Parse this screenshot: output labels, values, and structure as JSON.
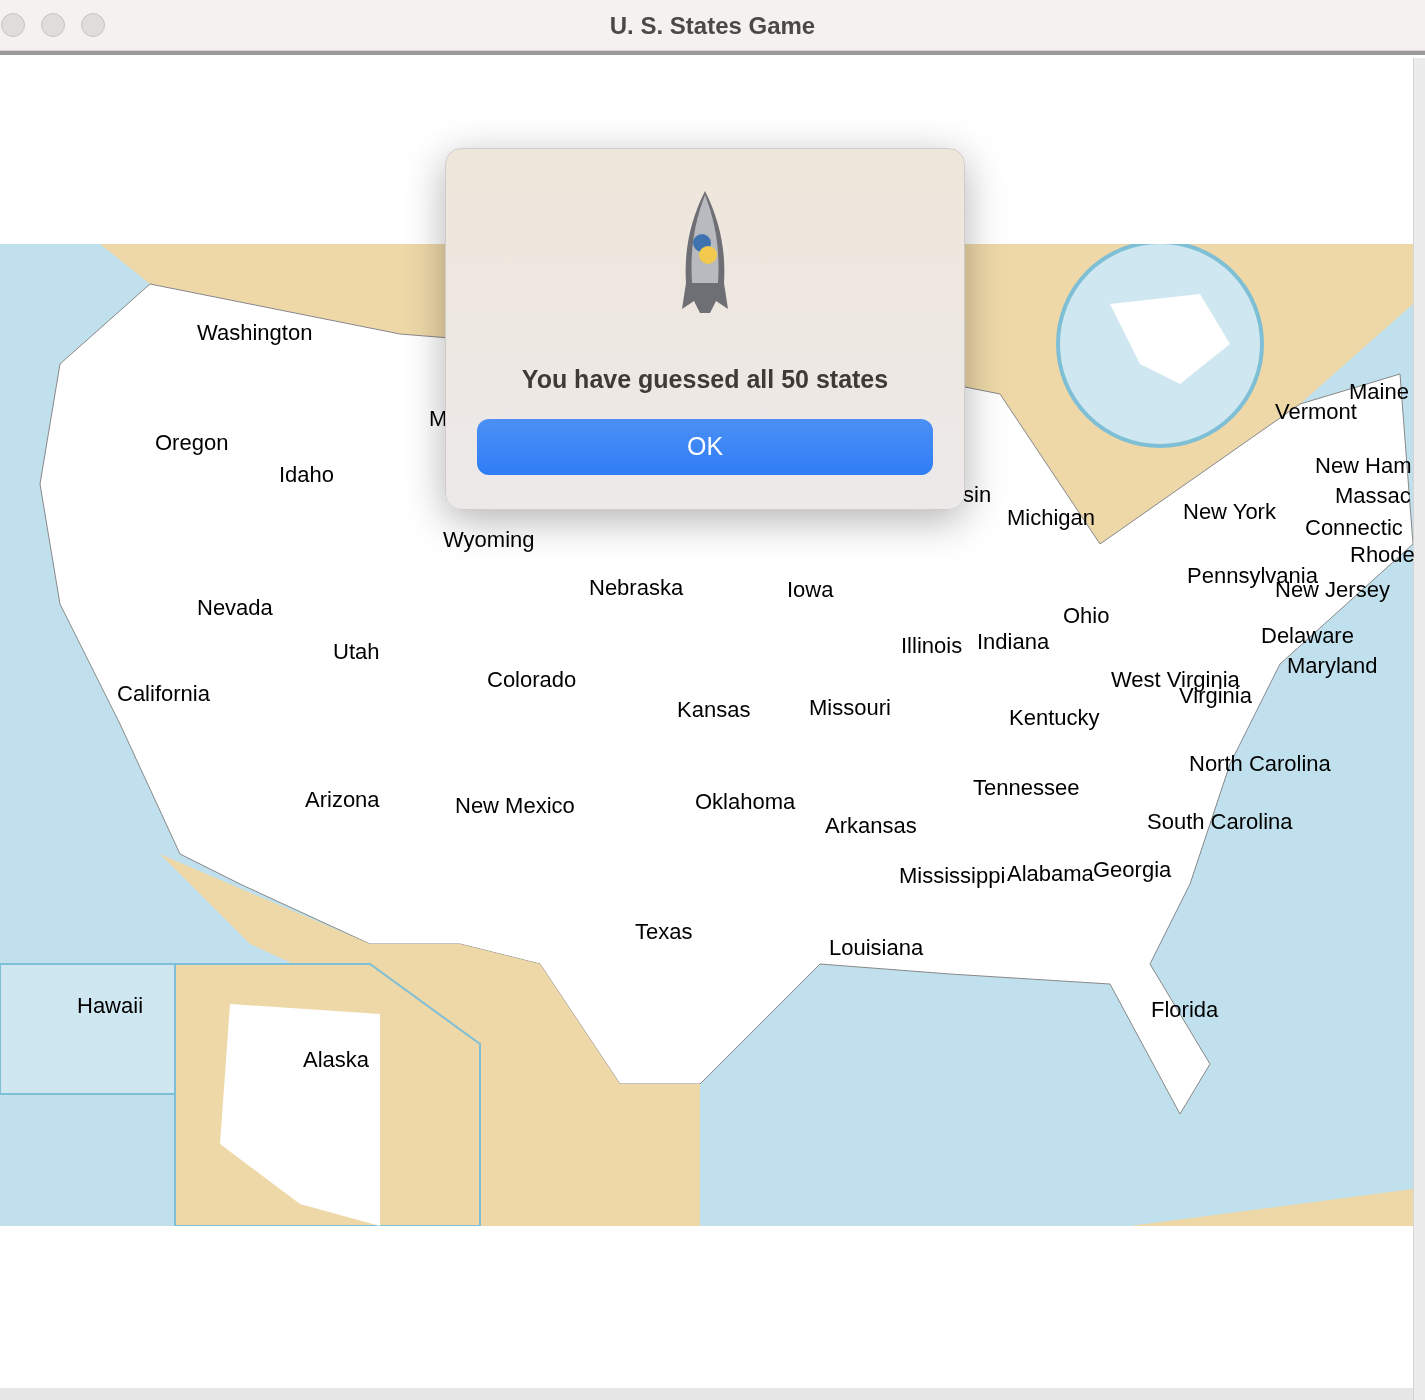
{
  "window": {
    "title": "U. S. States Game"
  },
  "map_labels": [
    "Washington",
    "M",
    "Maine",
    "Vermont",
    "Oregon",
    "New Ham",
    "Idaho",
    "sin",
    "Massac",
    "New York",
    "Michigan",
    "Connectic",
    "Rhode",
    "Wyoming",
    "Pennsylvania",
    "Nebraska",
    "Iowa",
    "New Jersey",
    "Nevada",
    "Utah",
    "Illinois",
    "Indiana",
    "Ohio",
    "Delaware",
    "California",
    "Colorado",
    "Kansas",
    "Missouri",
    "Kentucky",
    "West Virginia",
    "Virginia",
    "Maryland",
    "North Carolina",
    "Tennessee",
    "Arizona",
    "New Mexico",
    "Oklahoma",
    "Arkansas",
    "South Carolina",
    "Mississippi",
    "Alabama",
    "Georgia",
    "Texas",
    "Louisiana",
    "Hawaii",
    "Florida",
    "Alaska"
  ],
  "dialog": {
    "message": "You have guessed all 50 states",
    "buttons": [
      "OK"
    ]
  }
}
